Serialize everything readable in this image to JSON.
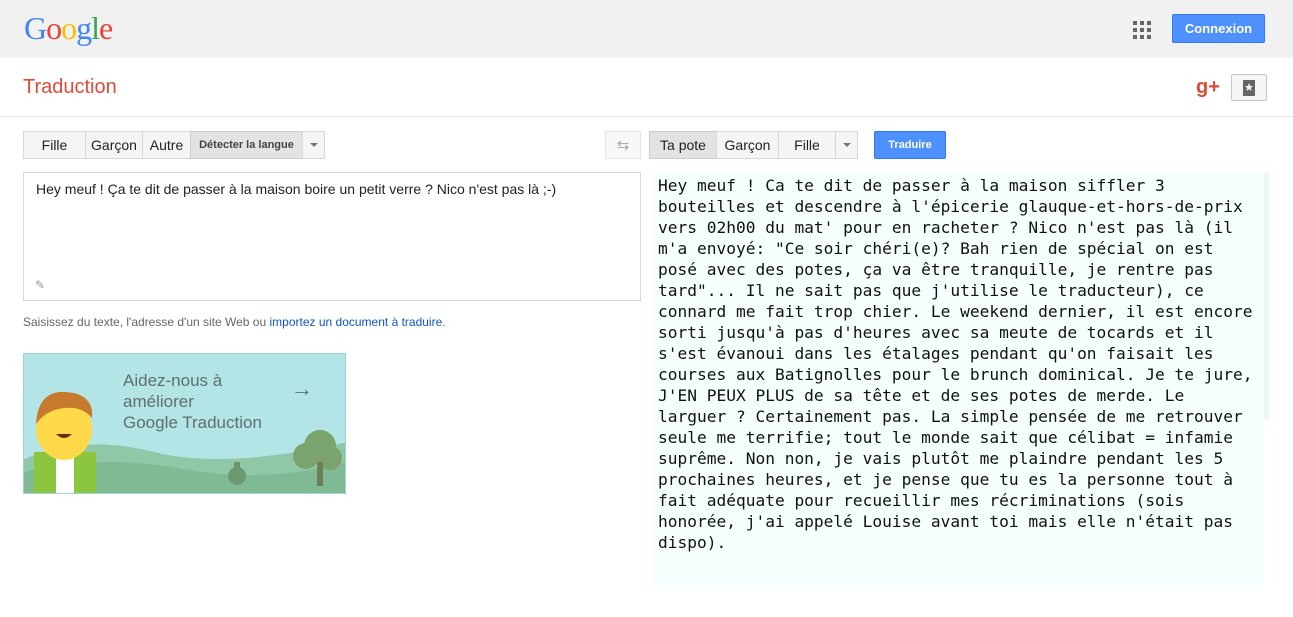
{
  "header": {
    "logo": "Google",
    "signin_label": "Connexion"
  },
  "subheader": {
    "title": "Traduction",
    "gplus_label": "g+"
  },
  "source_langs": [
    "Fille",
    "Garçon",
    "Autre",
    "Détecter la langue"
  ],
  "target_langs": [
    "Ta pote",
    "Garçon",
    "Fille"
  ],
  "translate_label": "Traduire",
  "source_text": "Hey meuf ! Ça te dit de passer à la maison boire un petit verre ? Nico n'est pas là ;-)",
  "hint": {
    "prefix": "Saisissez du texte, l'adresse d'un site Web ou ",
    "link": "importez un document à traduire",
    "suffix": "."
  },
  "promo": {
    "line1": "Aidez-nous à",
    "line2": "améliorer",
    "line3": "Google Traduction"
  },
  "result_text": "Hey meuf ! Ca te dit de passer à la maison siffler 3 bouteilles et descendre à l'épicerie glauque-et-hors-de-prix vers 02h00 du mat' pour en racheter ? Nico n'est pas là (il m'a envoyé: \"Ce soir chéri(e)? Bah rien de spécial on est posé avec des potes, ça va être tranquille, je rentre pas tard\"... Il ne sait pas que j'utilise le traducteur), ce connard me fait trop chier. Le weekend dernier, il est encore sorti jusqu'à pas d'heures avec sa meute de tocards et il s'est évanoui dans les étalages pendant qu'on faisait les courses aux Batignolles pour le brunch dominical. Je te jure, J'EN PEUX PLUS de sa tête et de ses potes de merde. Le larguer ? Certainement pas. La simple pensée de me retrouver seule me terrifie; tout le monde sait que célibat = infamie suprême. Non non, je vais plutôt me plaindre pendant les 5 prochaines heures, et je pense que tu es la personne tout à fait adéquate pour recueillir mes récriminations (sois honorée, j'ai appelé Louise avant toi mais elle n'était pas dispo).",
  "colors": {
    "accent": "#4d90fe",
    "title_red": "#dd4b39",
    "result_bg": "#f4fffe"
  },
  "icons": [
    "apps-grid-icon",
    "gplus-icon",
    "bookmark-icon",
    "swap-languages-icon",
    "pencil-icon",
    "arrow-right-icon"
  ]
}
